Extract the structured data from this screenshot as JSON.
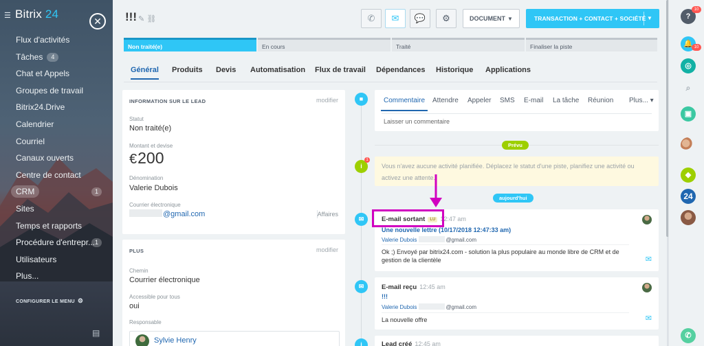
{
  "sidebar": {
    "logo_text": "Bitrix",
    "logo_num": " 24",
    "close_icon": "close-icon",
    "items": [
      {
        "label": "Flux d'activités",
        "count": ""
      },
      {
        "label": "Tâches",
        "count": "4"
      },
      {
        "label": "Chat et Appels",
        "count": ""
      },
      {
        "label": "Groupes de travail",
        "count": ""
      },
      {
        "label": "Bitrix24.Drive",
        "count": ""
      },
      {
        "label": "Calendrier",
        "count": ""
      },
      {
        "label": "Courriel",
        "count": ""
      },
      {
        "label": "Canaux ouverts",
        "count": ""
      },
      {
        "label": "Centre de contact",
        "count": ""
      },
      {
        "label": "CRM",
        "count": "",
        "right_count": "1"
      },
      {
        "label": "Sites",
        "count": ""
      },
      {
        "label": "Temps et rapports",
        "count": ""
      },
      {
        "label": "Procédure d'entrepr...",
        "count": "",
        "right_count": "1"
      },
      {
        "label": "Utilisateurs",
        "count": ""
      },
      {
        "label": "Plus...",
        "count": ""
      }
    ],
    "configure_label": "CONFIGURER LE MENU"
  },
  "header": {
    "title": "!!!",
    "document_label": "DOCUMENT",
    "create_label": "TRANSACTION + CONTACT + SOCIÉTÉ"
  },
  "stages": [
    "Non traité(e)",
    "En cours",
    "Traité",
    "Finaliser la piste"
  ],
  "tabs": [
    "Général",
    "Produits",
    "Devis",
    "Automatisation",
    "Flux de travail",
    "Dépendances",
    "Historique",
    "Applications"
  ],
  "lead_info": {
    "title": "INFORMATION SUR LE LEAD",
    "edit": "modifier",
    "status_label": "Statut",
    "status_value": "Non traité(e)",
    "amount_label": "Montant et devise",
    "amount_currency": "€",
    "amount_value": "200",
    "name_label": "Dénomination",
    "name_value": "Valerie Dubois",
    "email_label": "Courrier électronique",
    "email_domain": "@gmail.com",
    "email_side": "Affaires"
  },
  "plus_card": {
    "title": "PLUS",
    "edit": "modifier",
    "path_label": "Chemin",
    "path_value": "Courrier électronique",
    "access_label": "Accessible pour tous",
    "access_value": "oui",
    "resp_label": "Responsable",
    "resp_value": "Sylvie Henry"
  },
  "composer": {
    "tabs": [
      "Commentaire",
      "Attendre",
      "Appeler",
      "SMS",
      "E-mail",
      "La tâche",
      "Réunion",
      "Plus..."
    ],
    "placeholder": "Laisser un commentaire"
  },
  "timeline": {
    "planned_label": "Prévu",
    "notice_text": "Vous n'avez aucune activité planifiée. Déplacez le statut d'une piste, planifiez une activité ou activez une attente.",
    "notice_badge": "1",
    "today_label": "aujourd'hui",
    "activities": [
      {
        "title": "E-mail sortant",
        "badge": "LU",
        "time": "12:47 am",
        "subject": "Une nouvelle lettre (10/17/2018 12:47:33 am)",
        "from_name": "Valerie Dubois",
        "from_domain": "@gmail.com",
        "body": "Ok ;) Envoyé par bitrix24.com - solution la plus populaire au monde libre de CRM et de gestion de la clientèle"
      },
      {
        "title": "E-mail reçu",
        "time": "12:45 am",
        "subject": "!!!",
        "from_name": "Valerie Dubois",
        "from_domain": "@gmail.com",
        "body": "La nouvelle offre"
      },
      {
        "title": "Lead créé",
        "time": "12:45 am"
      }
    ]
  },
  "rightbar": {
    "help_badge": "10",
    "notif_badge": "10",
    "num_badge": "24"
  },
  "colors": {
    "accent": "#2fc6f6",
    "link": "#2067b0",
    "highlight": "#d100c0",
    "green": "#9dcf00"
  }
}
